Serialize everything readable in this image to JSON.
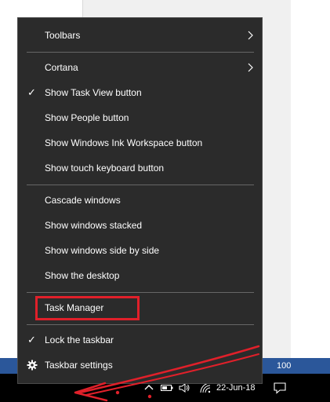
{
  "menu": {
    "items": [
      {
        "label": "Toolbars",
        "submenu": true,
        "checked": false
      },
      {
        "label": "Cortana",
        "submenu": true,
        "checked": false
      },
      {
        "label": "Show Task View button",
        "submenu": false,
        "checked": true
      },
      {
        "label": "Show People button",
        "submenu": false,
        "checked": false
      },
      {
        "label": "Show Windows Ink Workspace button",
        "submenu": false,
        "checked": false
      },
      {
        "label": "Show touch keyboard button",
        "submenu": false,
        "checked": false
      },
      {
        "label": "Cascade windows",
        "submenu": false,
        "checked": false
      },
      {
        "label": "Show windows stacked",
        "submenu": false,
        "checked": false
      },
      {
        "label": "Show windows side by side",
        "submenu": false,
        "checked": false
      },
      {
        "label": "Show the desktop",
        "submenu": false,
        "checked": false
      },
      {
        "label": "Task Manager",
        "submenu": false,
        "checked": false,
        "highlighted": true
      },
      {
        "label": "Lock the taskbar",
        "submenu": false,
        "checked": true
      },
      {
        "label": "Taskbar settings",
        "submenu": false,
        "checked": false,
        "icon": "gear-icon"
      }
    ],
    "check_glyph": "✓"
  },
  "taskbar": {
    "clock": "22-Jun-18",
    "tray_icons": [
      "chevron-up-icon",
      "battery-icon",
      "volume-icon",
      "wifi-icon",
      "notification-icon"
    ]
  },
  "background": {
    "zoom_text": "100"
  },
  "colors": {
    "menu_bg": "#2b2b2b",
    "highlight": "#e0202a",
    "taskbar": "#000000",
    "status_strip": "#2b579a"
  }
}
